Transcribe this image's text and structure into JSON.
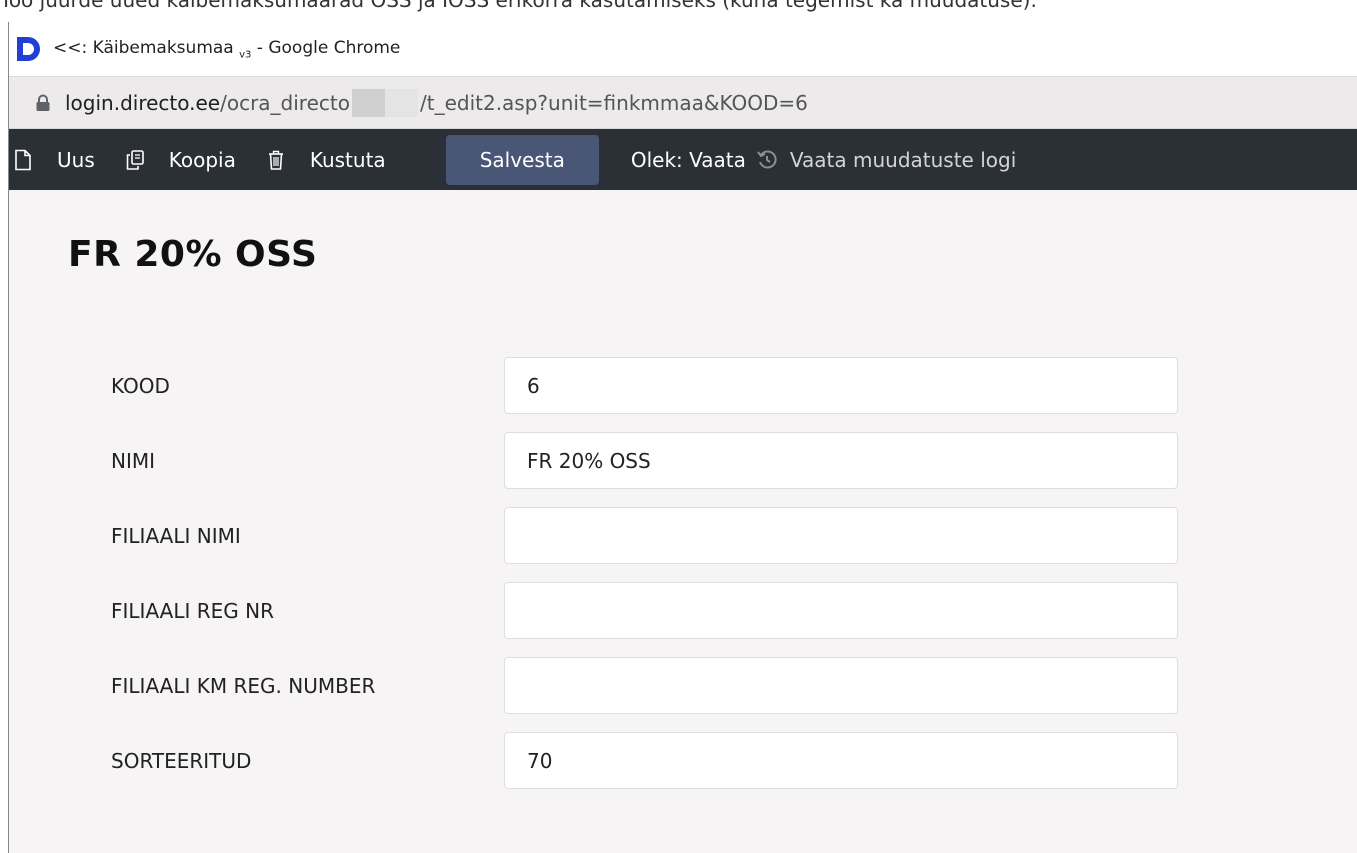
{
  "doc_overlay": {
    "text": "Too juurde uued käibemaksumäärad OSS ja IOSS erikorra kasutamiseks (kuna tegemist ka muudatuse)."
  },
  "window": {
    "title_prefix": "<<: Käibemaksumaa ",
    "title_subscript": "v3",
    "title_suffix": " - Google Chrome"
  },
  "address": {
    "host": "login.directo.ee",
    "path_before": "/ocra_directo",
    "path_after": "/t_edit2.asp?unit=finkmmaa&KOOD=6"
  },
  "toolbar": {
    "new_label": "Uus",
    "copy_label": "Koopia",
    "delete_label": "Kustuta",
    "save_label": "Salvesta",
    "state_label": "Olek: Vaata",
    "log_label": "Vaata muudatuste logi"
  },
  "page": {
    "title": "FR 20% OSS"
  },
  "form": {
    "fields": [
      {
        "label": "KOOD",
        "value": "6"
      },
      {
        "label": "NIMI",
        "value": "FR 20% OSS"
      },
      {
        "label": "FILIAALI NIMI",
        "value": ""
      },
      {
        "label": "FILIAALI REG NR",
        "value": ""
      },
      {
        "label": "FILIAALI KM REG. NUMBER",
        "value": ""
      },
      {
        "label": "SORTEERITUD",
        "value": "70"
      }
    ]
  },
  "colors": {
    "toolbar_bg": "#2b3036",
    "save_button_bg": "#4a5675",
    "logo_blue": "#1f3fd6",
    "content_bg": "#f6f4f4"
  },
  "icons": {
    "app": "directo-logo-icon",
    "lock": "lock-icon",
    "new": "new-document-icon",
    "copy": "copy-icon",
    "delete": "trash-icon",
    "history": "history-icon"
  }
}
